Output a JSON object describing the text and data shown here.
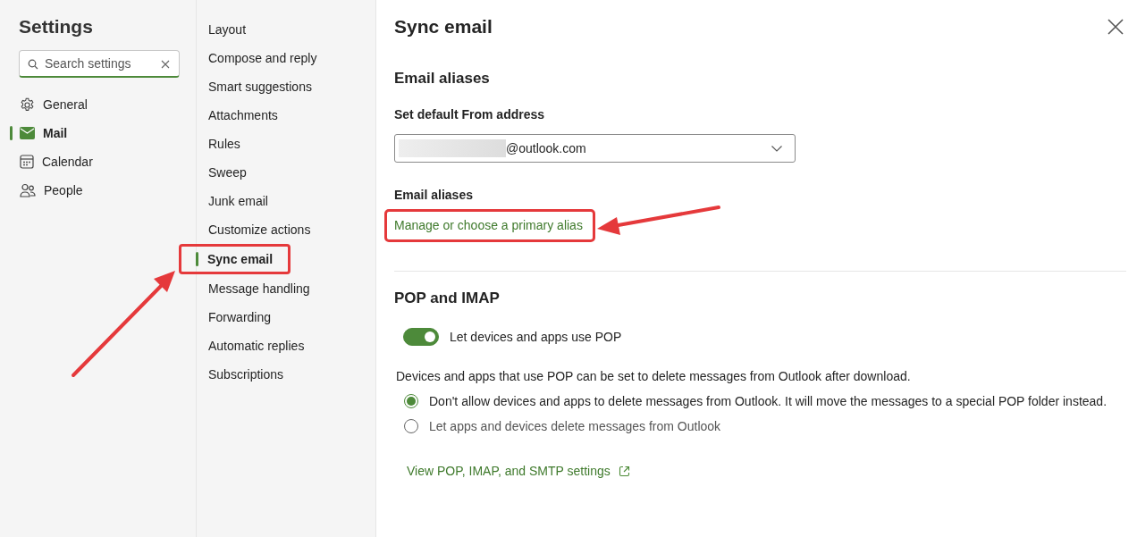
{
  "sidebar": {
    "title": "Settings",
    "search": {
      "placeholder": "Search settings"
    },
    "items": [
      {
        "label": "General",
        "kind": "gear",
        "selected": false
      },
      {
        "label": "Mail",
        "kind": "mail",
        "selected": true
      },
      {
        "label": "Calendar",
        "kind": "calendar",
        "selected": false
      },
      {
        "label": "People",
        "kind": "people",
        "selected": false
      }
    ]
  },
  "subnav": {
    "items": [
      {
        "label": "Layout",
        "selected": false,
        "highlighted": false
      },
      {
        "label": "Compose and reply",
        "selected": false,
        "highlighted": false
      },
      {
        "label": "Smart suggestions",
        "selected": false,
        "highlighted": false
      },
      {
        "label": "Attachments",
        "selected": false,
        "highlighted": false
      },
      {
        "label": "Rules",
        "selected": false,
        "highlighted": false
      },
      {
        "label": "Sweep",
        "selected": false,
        "highlighted": false
      },
      {
        "label": "Junk email",
        "selected": false,
        "highlighted": false
      },
      {
        "label": "Customize actions",
        "selected": false,
        "highlighted": false
      },
      {
        "label": "Sync email",
        "selected": true,
        "highlighted": true
      },
      {
        "label": "Message handling",
        "selected": false,
        "highlighted": false
      },
      {
        "label": "Forwarding",
        "selected": false,
        "highlighted": false
      },
      {
        "label": "Automatic replies",
        "selected": false,
        "highlighted": false
      },
      {
        "label": "Subscriptions",
        "selected": false,
        "highlighted": false
      }
    ]
  },
  "panel": {
    "title": "Sync email",
    "aliases_section": {
      "heading": "Email aliases",
      "from_label": "Set default From address",
      "from_value": "@outlook.com",
      "aliases_label": "Email aliases",
      "link": {
        "label": "Manage or choose a primary alias",
        "highlighted": true
      }
    },
    "pop_section": {
      "heading": "POP and IMAP",
      "toggle": {
        "label": "Let devices and apps use POP",
        "on": true
      },
      "description": "Devices and apps that use POP can be set to delete messages from Outlook after download.",
      "options": [
        {
          "label": "Don't allow devices and apps to delete messages from Outlook. It will move the messages to a special POP folder instead.",
          "selected": true
        },
        {
          "label": "Let apps and devices delete messages from Outlook",
          "selected": false
        }
      ],
      "link": "View POP, IMAP, and SMTP settings"
    }
  }
}
